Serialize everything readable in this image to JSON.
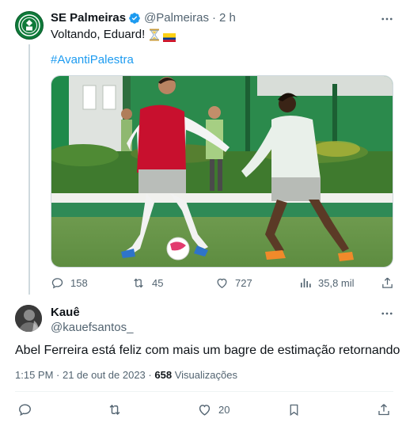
{
  "tweet": {
    "author_name": "SE Palmeiras",
    "author_handle": "@Palmeiras",
    "separator": "·",
    "time_ago": "2 h",
    "text": "Voltando, Eduard!",
    "text_emojis": [
      "hourglass",
      "colombia-flag"
    ],
    "hashtag": "#AvantiPalestra",
    "stats": {
      "replies": "158",
      "retweets": "45",
      "likes": "727",
      "views": "35,8 mil"
    }
  },
  "reply": {
    "author_name": "Kauê",
    "author_handle": "@kauefsantos_",
    "text": "Abel Ferreira está feliz com mais um bagre de estimação retornando",
    "timestamp": "1:15 PM · 21 de out de 2023 ·",
    "views_count": "658",
    "views_label": "Visualizações",
    "stats": {
      "likes": "20"
    }
  },
  "icons": {
    "reply": "comment-icon",
    "retweet": "retweet-icon",
    "like": "heart-icon",
    "views": "analytics-icon",
    "share": "share-icon",
    "bookmark": "bookmark-icon",
    "more": "more-icon"
  },
  "colors": {
    "accent": "#1d9bf0",
    "muted": "#536471",
    "palmeiras_green": "#0f7a3a",
    "jersey_red": "#c8102e"
  }
}
